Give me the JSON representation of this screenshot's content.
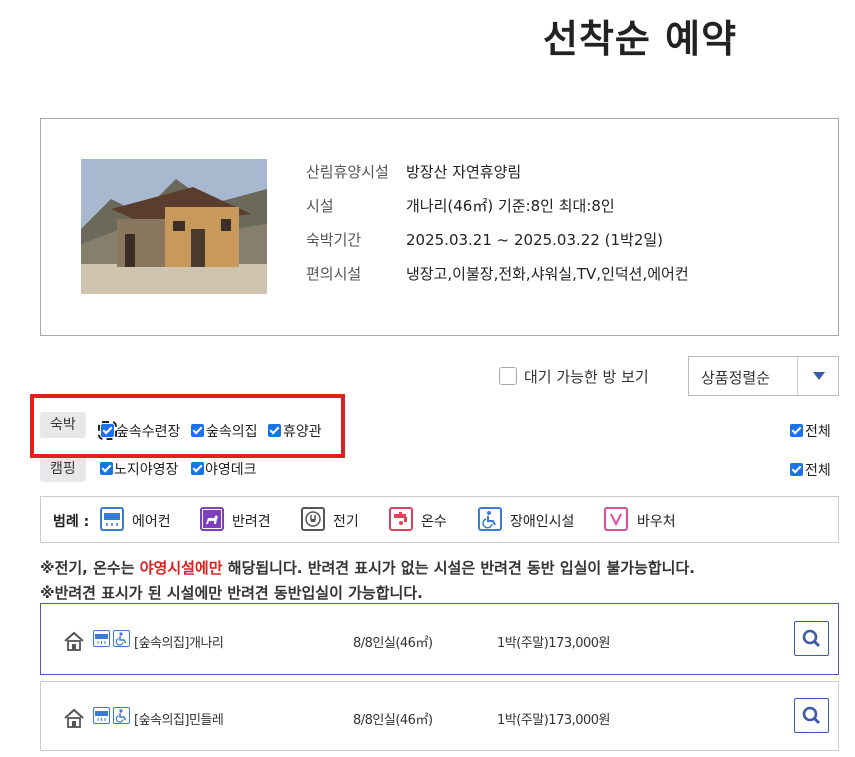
{
  "page": {
    "title": "선착순 예약"
  },
  "info": {
    "rows": [
      {
        "label": "산림휴양시설",
        "value": "방장산 자연휴양림"
      },
      {
        "label": "시설",
        "value": "개나리(46㎡) 기준:8인 최대:8인"
      },
      {
        "label": "숙박기간",
        "value": "2025.03.21 ~ 2025.03.22 (1박2일)"
      },
      {
        "label": "편의시설",
        "value": "냉장고,이불장,전화,샤워실,TV,인덕션,에어컨"
      }
    ]
  },
  "waiting": {
    "label": "대기 가능한 방 보기",
    "checked": false
  },
  "sort": {
    "selected": "상품정렬순"
  },
  "filters": {
    "lodging": {
      "tag": "숙박",
      "options": [
        "숲속수련장",
        "숲속의집",
        "휴양관"
      ],
      "all_label": "전체"
    },
    "camping": {
      "tag": "캠핑",
      "options": [
        "노지야영장",
        "야영데크"
      ],
      "all_label": "전체"
    }
  },
  "legend": {
    "title": "범례 :",
    "items": [
      {
        "label": "에어컨",
        "icon": "air-conditioner-icon",
        "color": "#3a7bd5"
      },
      {
        "label": "반려견",
        "icon": "pet-dog-icon",
        "color": "#7b3fbf"
      },
      {
        "label": "전기",
        "icon": "electric-plug-icon",
        "color": "#555555"
      },
      {
        "label": "온수",
        "icon": "hot-water-icon",
        "color": "#e0405a"
      },
      {
        "label": "장애인시설",
        "icon": "wheelchair-icon",
        "color": "#3a7bd5"
      },
      {
        "label": "바우처",
        "icon": "voucher-icon",
        "color": "#d94f9a"
      }
    ]
  },
  "notices": {
    "line1_prefix": "※전기, 온수는 ",
    "line1_highlight": "야영시설에만",
    "line1_suffix": " 해당됩니다. 반려견 표시가 없는 시설은 반려견 동반 입실이 불가능합니다.",
    "line2": "※반려견 표시가 된 시설에만 반려견 동반입실이 가능합니다."
  },
  "rooms": [
    {
      "name": "[숲속의집]개나리",
      "capacity": "8/8인실(46㎡)",
      "price": "1박(주말)173,000원"
    },
    {
      "name": "[숲속의집]민들레",
      "capacity": "8/8인실(46㎡)",
      "price": "1박(주말)173,000원"
    }
  ],
  "colors": {
    "accent": "#3f5aa8",
    "highlight": "#e11d1d",
    "checkbox": "#1a73e8"
  }
}
